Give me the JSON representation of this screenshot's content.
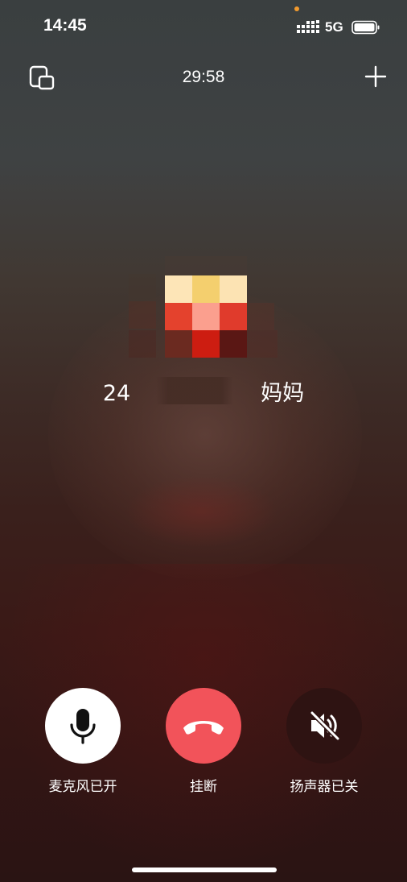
{
  "status_bar": {
    "time": "14:45",
    "network": "5G",
    "icons": [
      "signal-icon",
      "battery-icon",
      "camera-in-use-dot"
    ]
  },
  "call": {
    "duration": "29:58",
    "contact_name_visible": "24      妈妈"
  },
  "top_bar": {
    "minimize_icon": "floating-window-icon",
    "add_icon": "plus-icon"
  },
  "controls": {
    "mic": {
      "label": "麦克风已开",
      "icon": "microphone-icon"
    },
    "hangup": {
      "label": "挂断",
      "icon": "phone-hangup-icon"
    },
    "speaker": {
      "label": "扬声器已关",
      "icon": "speaker-muted-icon"
    }
  },
  "colors": {
    "hangup": "#f2535a",
    "mic_bg": "#ffffff",
    "speaker_bg": "#2e1312",
    "camera_dot": "#f29a2e"
  }
}
